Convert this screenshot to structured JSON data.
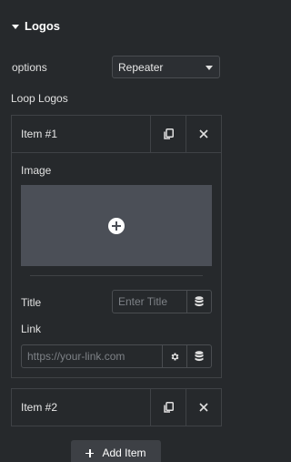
{
  "section": {
    "title": "Logos",
    "caret_icon": "caret-down-icon"
  },
  "options": {
    "label": "options",
    "selected": "Repeater",
    "dropdown_icon": "chevron-down-icon"
  },
  "loop": {
    "label": "Loop Logos",
    "items": [
      {
        "title": "Item #1",
        "duplicate_icon": "copy-icon",
        "remove_icon": "close-icon",
        "expanded": true,
        "image_label": "Image",
        "add_media_icon": "plus-circle-icon",
        "title_label": "Title",
        "title_placeholder": "Enter Title",
        "title_value": "",
        "dynamic_icon": "database-icon",
        "link_label": "Link",
        "link_placeholder": "https://your-link.com",
        "link_value": "",
        "settings_icon": "gear-icon"
      },
      {
        "title": "Item #2",
        "duplicate_icon": "copy-icon",
        "remove_icon": "close-icon",
        "expanded": false
      }
    ],
    "add_label": "Add Item"
  },
  "colors": {
    "background": "#26292c",
    "border": "#3f4246",
    "media_placeholder": "#4b4f57",
    "add_button": "#3d4045",
    "text": "#e0e0e0"
  }
}
